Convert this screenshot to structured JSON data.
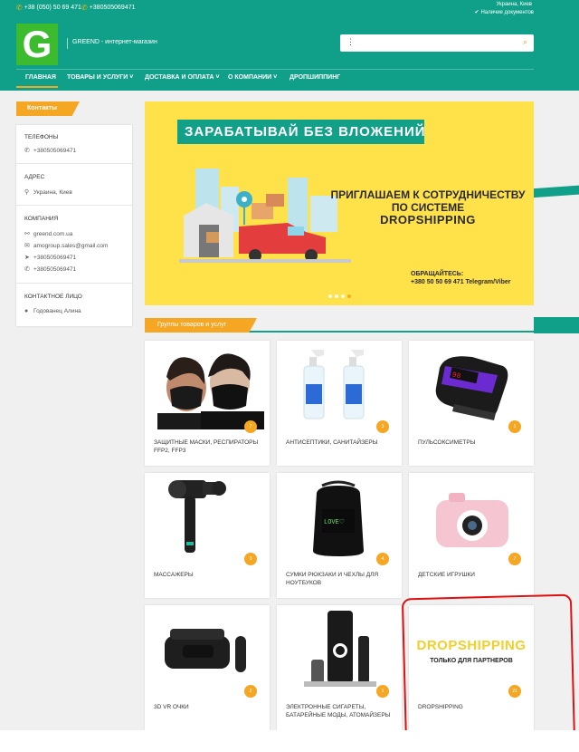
{
  "topbar": {
    "phone1": "+38 (050) 50 69 471",
    "phone2": "+380505069471",
    "city": "Украина, Киев",
    "availability": "Наличие документов"
  },
  "header": {
    "logo_letter": "G",
    "site_name": "GREEND - интернет-магазин",
    "search_placeholder": ""
  },
  "nav": {
    "items": [
      {
        "label": "Главная"
      },
      {
        "label": "Товары и услуги"
      },
      {
        "label": "Доставка и оплата"
      },
      {
        "label": "О компании"
      },
      {
        "label": "Дропшиппинг"
      }
    ]
  },
  "sidebar": {
    "tag": "Контакты",
    "phones_title": "Телефоны",
    "phone": "+380505069471",
    "address_title": "Адрес",
    "address": "Украина, Киев",
    "company_title": "Компания",
    "company_site": "greend.com.ua",
    "company_email": "amogroup.sales@gmail.com",
    "company_telegram": "+380505069471",
    "company_viber": "+380505069471",
    "contact_title": "Контактное лицо",
    "contact_name": "Годованец Алина"
  },
  "banner": {
    "title": "ЗАРАБАТЫВАЙ БЕЗ ВЛОЖЕНИЙ",
    "invite_line1": "ПРИГЛАШАЕМ К СОТРУДНИЧЕСТВУ",
    "invite_line2": "ПО СИСТЕМЕ",
    "invite_line3": "DROPSHIPPING",
    "contact_line1": "ОБРАЩАЙТЕСЬ:",
    "contact_line2": "+380 50 50 69 471 Telegram/Viber"
  },
  "groups": {
    "title": "Группы товаров и услуг",
    "cards": [
      {
        "label": "Защитные маски, респираторы FFP2, FFP3",
        "count": "7"
      },
      {
        "label": "Антисептики, санитайзеры",
        "count": "3"
      },
      {
        "label": "Пульсоксиметры",
        "count": "1"
      },
      {
        "label": "Массажеры",
        "count": "3"
      },
      {
        "label": "Сумки рюкзаки и чехлы для ноутбуков",
        "count": "4"
      },
      {
        "label": "Детские игрушки",
        "count": "7"
      },
      {
        "label": "3D VR очки",
        "count": "2"
      },
      {
        "label": "Электронные сигареты, батарейные моды, атомайзеры",
        "count": "1"
      },
      {
        "label": "Dropshipping",
        "count": "21"
      }
    ],
    "drop_card_title": "DROPSHIPPING",
    "drop_card_sub": "ТОЛЬКО ДЛЯ ПАРТНЕРОВ",
    "backpack_text": "LOVE♡"
  },
  "colors": {
    "teal": "#10a089",
    "orange": "#f5a623",
    "banner_yellow": "#ffe14a",
    "annotation_red": "#dd1111"
  }
}
